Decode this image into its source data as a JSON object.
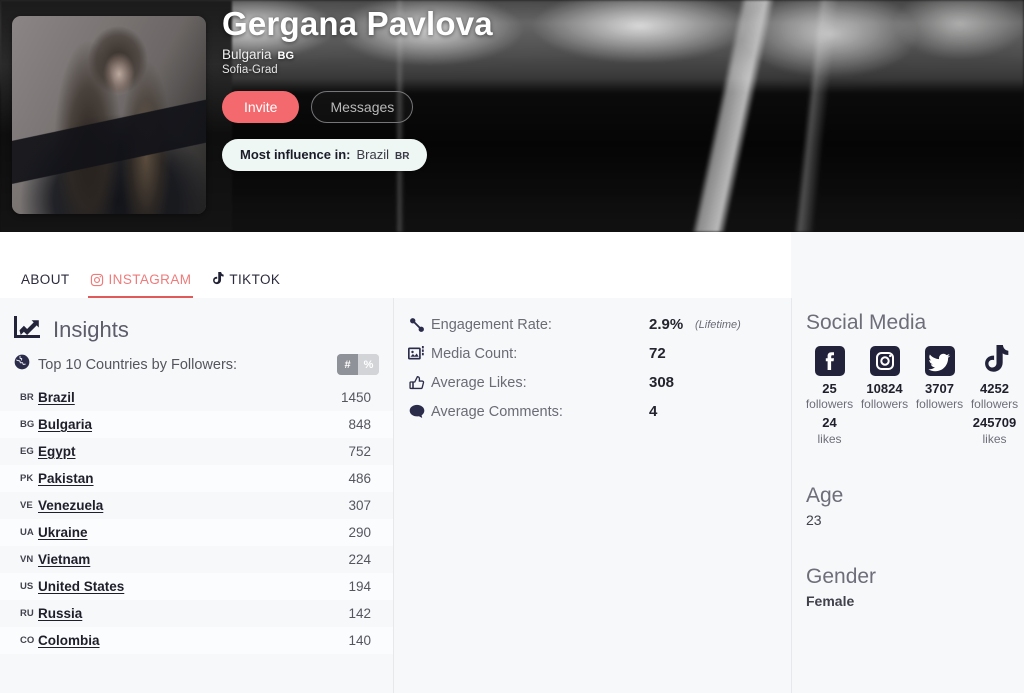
{
  "profile": {
    "name": "Gergana Pavlova",
    "country": "Bulgaria",
    "country_code": "BG",
    "region": "Sofia-Grad",
    "avatar_alt": "profile-photo",
    "invite_label": "Invite",
    "messages_label": "Messages",
    "influence_label": "Most influence in:",
    "influence_country": "Brazil",
    "influence_country_code": "BR",
    "accent_invite": "#f4696d",
    "badge_bg": "#eef7f3"
  },
  "tabs": [
    {
      "label": "ABOUT",
      "icon": "",
      "active": false
    },
    {
      "label": "INSTAGRAM",
      "icon": "instagram-icon",
      "active": true
    },
    {
      "label": "TIKTOK",
      "icon": "tiktok-icon",
      "active": false
    }
  ],
  "tab_accent": "#e05a5a",
  "insights": {
    "icon": "chart-line-up-icon",
    "title": "Insights",
    "countries_icon": "globe-icon",
    "countries_title": "Top 10 Countries by Followers:",
    "toggle": {
      "count_label": "#",
      "percent_label": "%",
      "active": "#"
    }
  },
  "chart_data": {
    "type": "bar",
    "title": "Top 10 Countries by Followers:",
    "xlabel": "",
    "ylabel": "Followers",
    "categories": [
      "Brazil",
      "Bulgaria",
      "Egypt",
      "Pakistan",
      "Venezuela",
      "Ukraine",
      "Vietnam",
      "United States",
      "Russia",
      "Colombia"
    ],
    "codes": [
      "BR",
      "BG",
      "EG",
      "PK",
      "VE",
      "UA",
      "VN",
      "US",
      "RU",
      "CO"
    ],
    "values": [
      1450,
      848,
      752,
      486,
      307,
      290,
      224,
      194,
      142,
      140
    ]
  },
  "metrics": [
    {
      "icon": "percent-icon",
      "label": "Engagement Rate:",
      "value": "2.9%",
      "sub": "(Lifetime)"
    },
    {
      "icon": "media-icon",
      "label": "Media Count:",
      "value": "72",
      "sub": ""
    },
    {
      "icon": "thumbs-up-icon",
      "label": "Average Likes:",
      "value": "308",
      "sub": ""
    },
    {
      "icon": "comment-icon",
      "label": "Average Comments:",
      "value": "4",
      "sub": ""
    }
  ],
  "sidebar": {
    "social_media_title": "Social Media",
    "networks": [
      {
        "icon": "facebook-icon",
        "count": "25",
        "unit": "followers",
        "count2": "24",
        "unit2": "likes"
      },
      {
        "icon": "instagram-icon",
        "count": "10824",
        "unit": "followers",
        "count2": "",
        "unit2": ""
      },
      {
        "icon": "twitter-icon",
        "count": "3707",
        "unit": "followers",
        "count2": "",
        "unit2": ""
      },
      {
        "icon": "tiktok-icon",
        "count": "4252",
        "unit": "followers",
        "count2": "245709",
        "unit2": "likes"
      }
    ],
    "age_title": "Age",
    "age_value": "23",
    "gender_title": "Gender",
    "gender_value": "Female"
  }
}
